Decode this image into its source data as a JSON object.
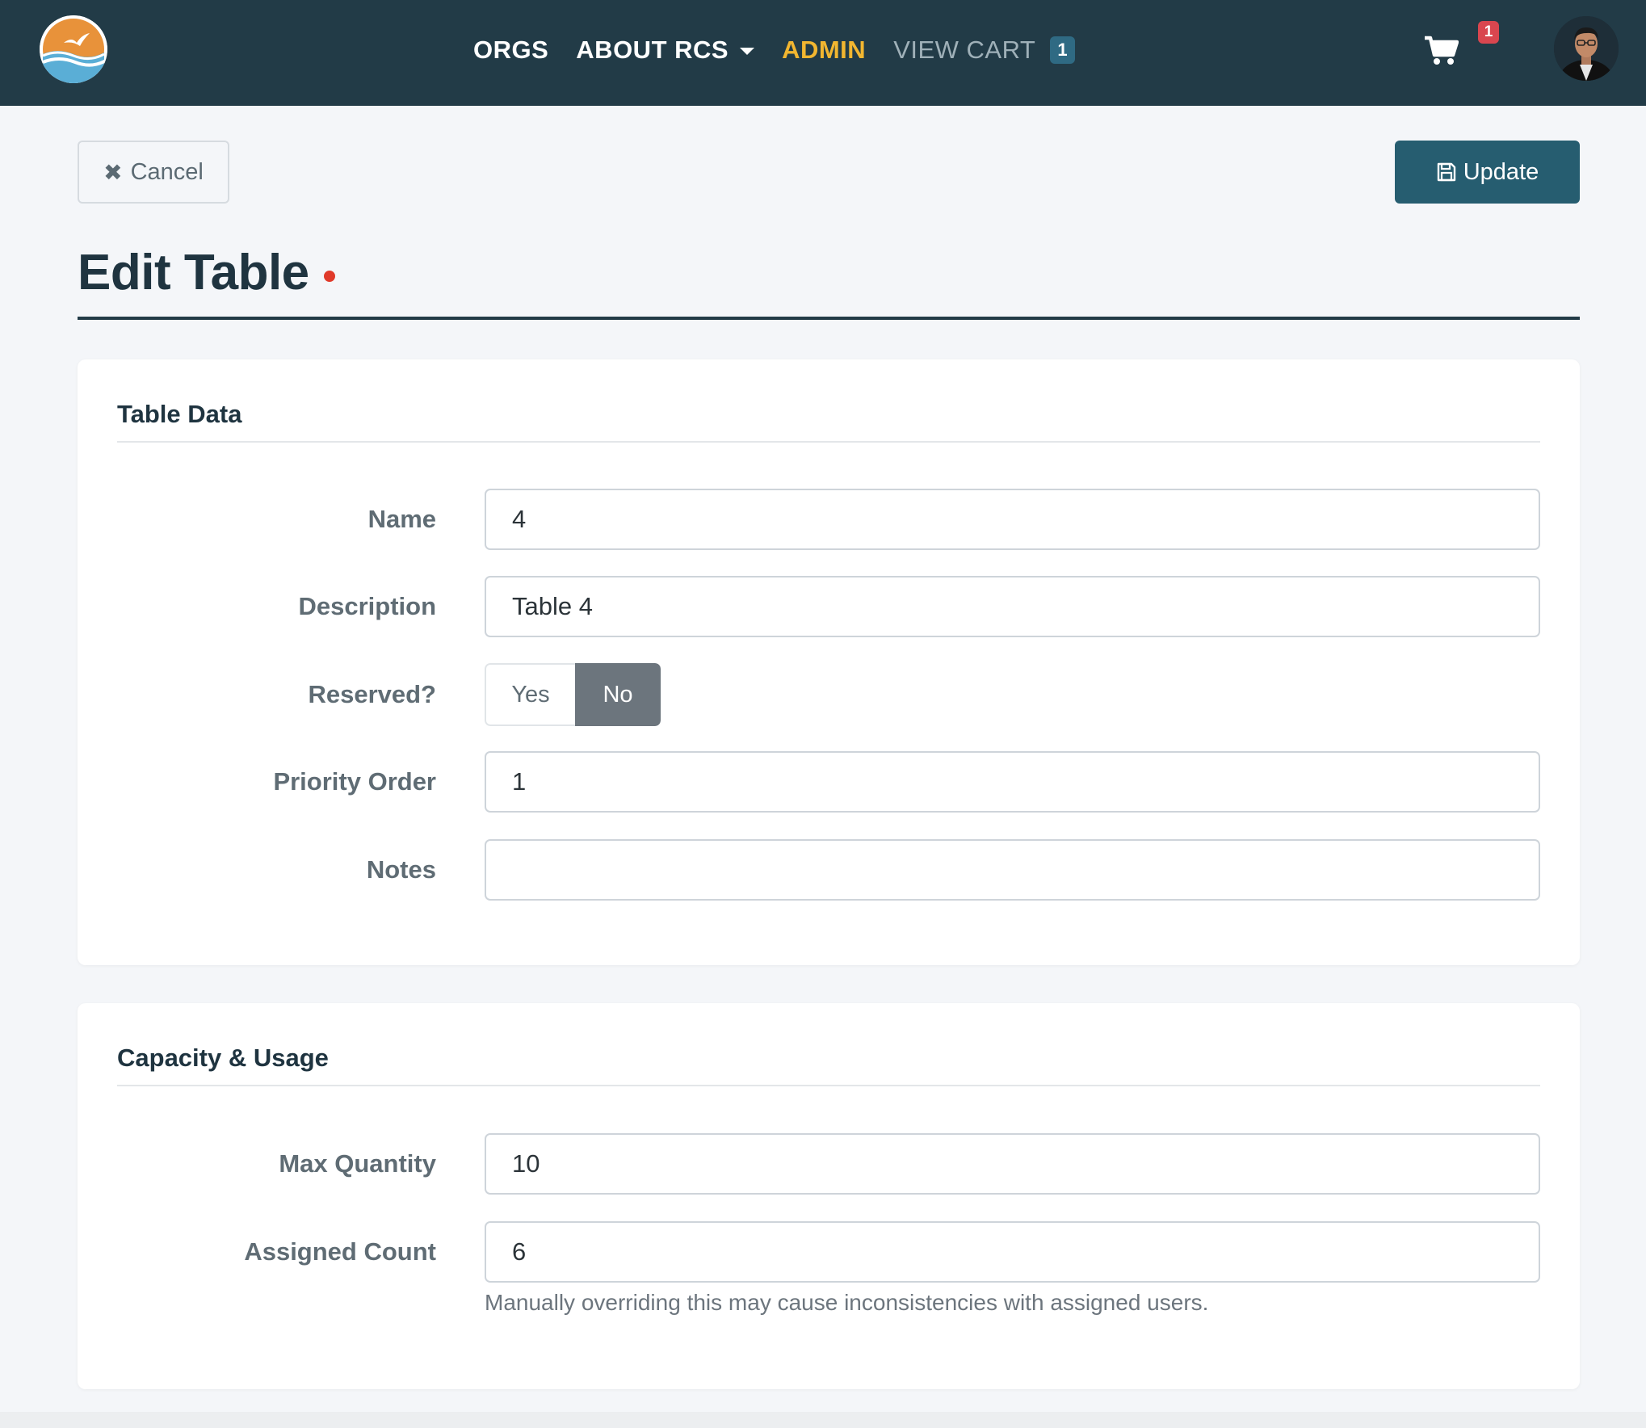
{
  "navbar": {
    "links": {
      "orgs": "ORGS",
      "about": "ABOUT RCS",
      "admin": "ADMIN",
      "cart": "VIEW CART"
    },
    "cart_count": "1",
    "notification_count": "1",
    "colors": {
      "background": "#223b47",
      "admin_accent": "#f2b630",
      "notification": "#d9464f"
    }
  },
  "toolbar": {
    "cancel_label": "Cancel",
    "update_label": "Update"
  },
  "page": {
    "title": "Edit Table"
  },
  "table_data": {
    "title": "Table Data",
    "name_label": "Name",
    "name_value": "4",
    "description_label": "Description",
    "description_value": "Table 4",
    "reserved_label": "Reserved?",
    "reserved_yes": "Yes",
    "reserved_no": "No",
    "reserved_selected": "No",
    "priority_label": "Priority Order",
    "priority_value": "1",
    "notes_label": "Notes",
    "notes_value": ""
  },
  "capacity": {
    "title": "Capacity & Usage",
    "max_label": "Max Quantity",
    "max_value": "10",
    "assigned_label": "Assigned Count",
    "assigned_value": "6",
    "assigned_help": "Manually overriding this may cause inconsistencies with assigned users."
  }
}
